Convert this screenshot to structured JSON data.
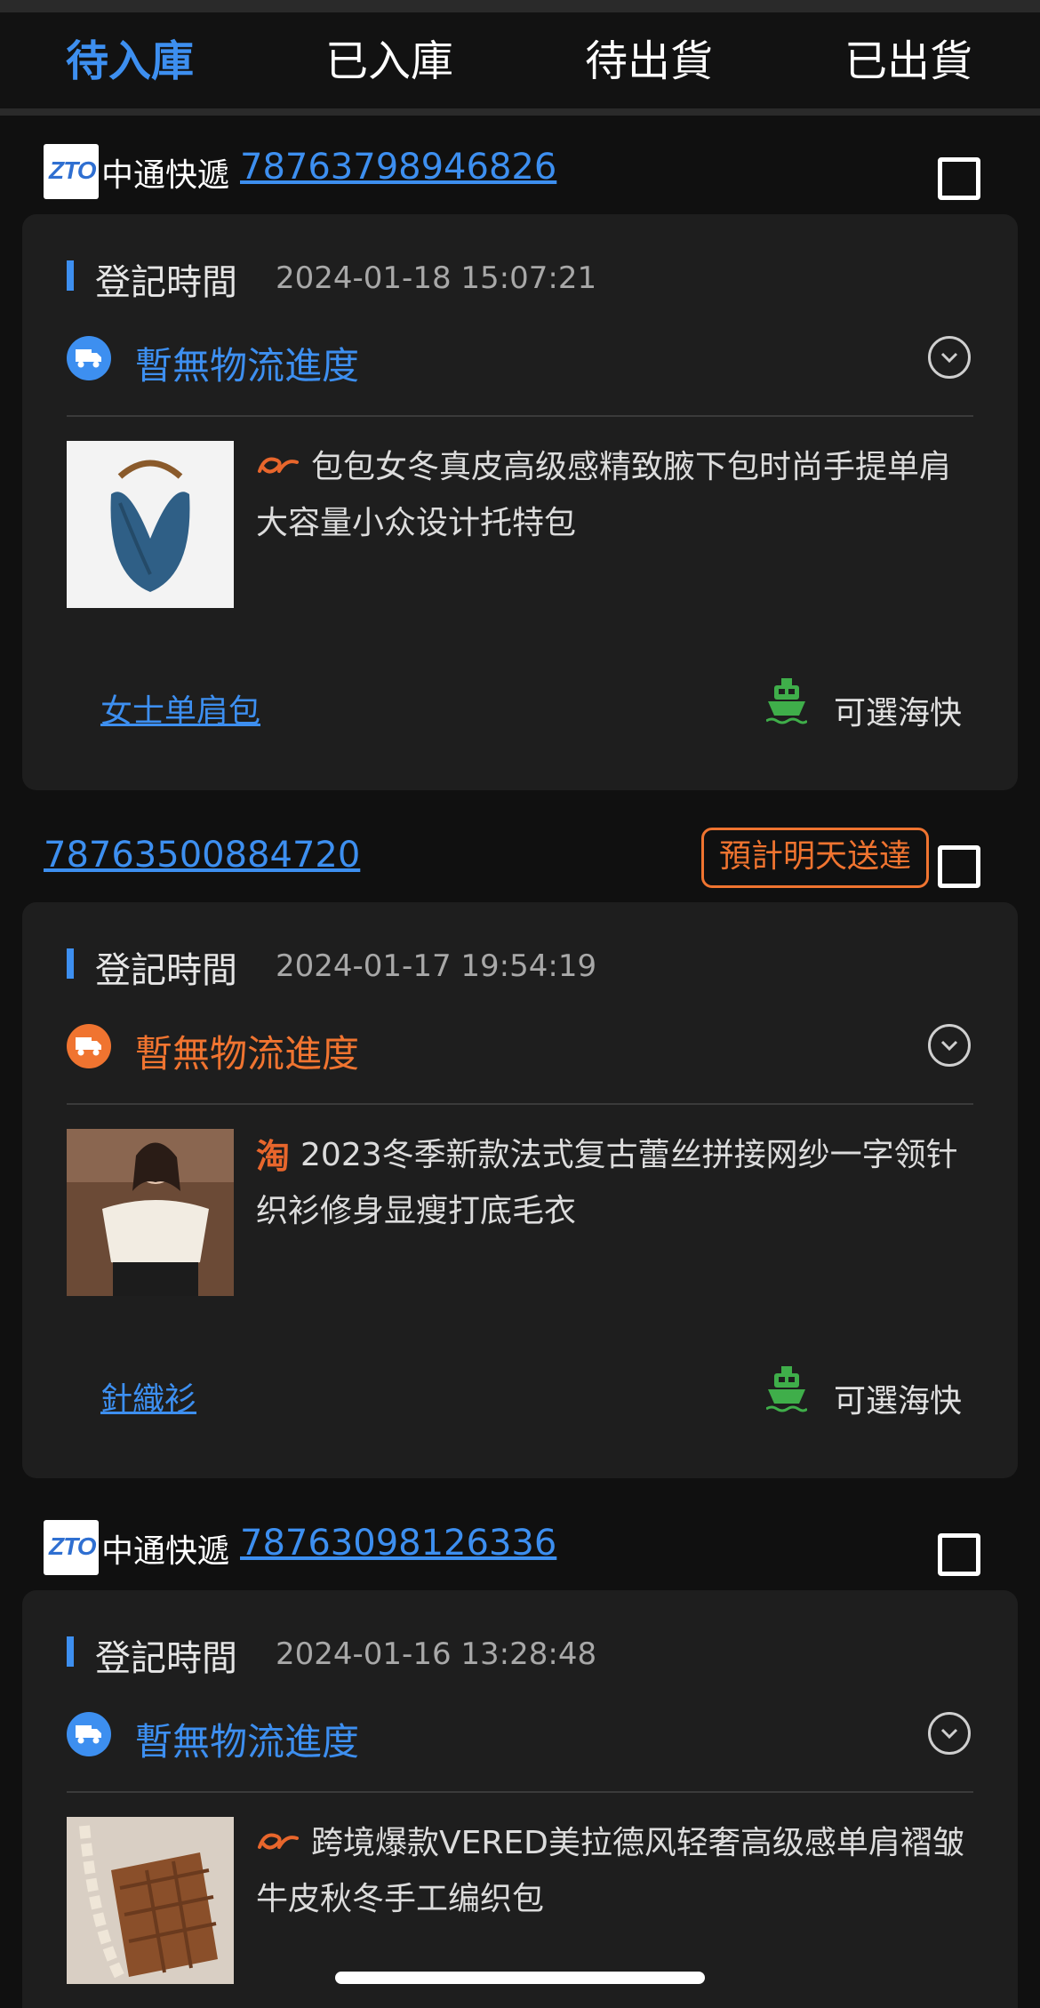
{
  "tabs": [
    "待入庫",
    "已入庫",
    "待出貨",
    "已出貨"
  ],
  "active_tab_index": 0,
  "colors": {
    "accent_blue": "#3d8ff0",
    "accent_orange": "#f07430",
    "ship_green": "#3fae4a",
    "card_bg": "#1e1e1e",
    "page_bg": "#101010"
  },
  "parcels": [
    {
      "carrier": "中通快遞",
      "carrier_logo": "ZTO",
      "tracking": "78763798946826",
      "eta_badge": "",
      "reg_label": "登記時間",
      "reg_time": "2024-01-18 15:07:21",
      "logistics": "暫無物流進度",
      "logistics_color": "#3d8ff0",
      "source_icon": "1688-icon",
      "product_title": "包包女冬真皮高级感精致腋下包时尚手提单肩大容量小众设计托特包",
      "category": "女士单肩包",
      "shipping": "可選海快"
    },
    {
      "carrier": "",
      "tracking": "78763500884720",
      "eta_badge": "預計明天送達",
      "reg_label": "登記時間",
      "reg_time": "2024-01-17 19:54:19",
      "logistics": "暫無物流進度",
      "logistics_color": "#f07430",
      "source_icon": "taobao-icon",
      "source_glyph": "淘",
      "product_title": "2023冬季新款法式复古蕾丝拼接网纱一字领针织衫修身显瘦打底毛衣",
      "category": "針織衫",
      "shipping": "可選海快"
    },
    {
      "carrier": "中通快遞",
      "carrier_logo": "ZTO",
      "tracking": "78763098126336",
      "eta_badge": "",
      "reg_label": "登記時間",
      "reg_time": "2024-01-16 13:28:48",
      "logistics": "暫無物流進度",
      "logistics_color": "#3d8ff0",
      "source_icon": "1688-icon",
      "product_title": "跨境爆款VERED美拉德风轻奢高级感单肩褶皱牛皮秋冬手工编织包"
    }
  ]
}
